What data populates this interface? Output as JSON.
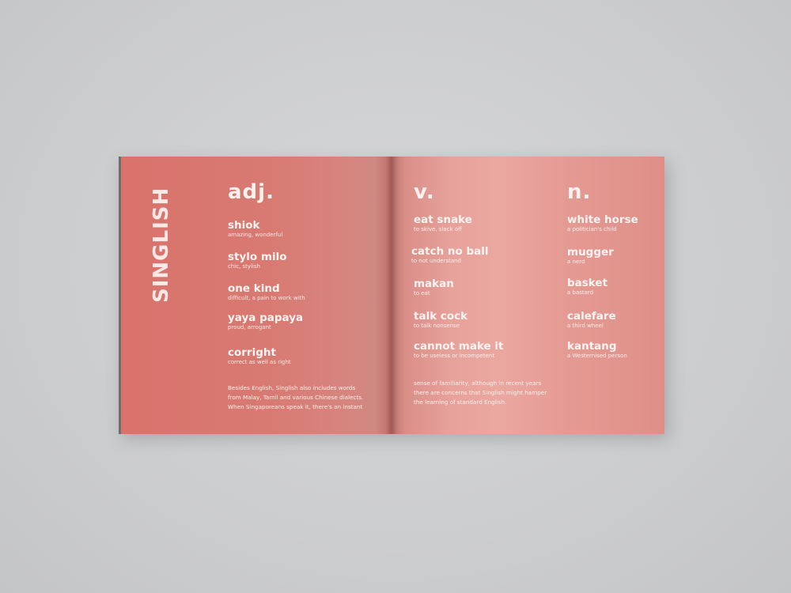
{
  "title": "SINGLISH",
  "adj": {
    "heading": "adj.",
    "entries": [
      {
        "term": "shiok",
        "definition": "amazing, wonderful"
      },
      {
        "term": "stylo milo",
        "definition": "chic, stylish"
      },
      {
        "term": "one kind",
        "definition": "difficult, a pain to work with"
      },
      {
        "term": "yaya papaya",
        "definition": "proud, arrogant"
      },
      {
        "term": "corright",
        "definition": "correct as well as right"
      }
    ]
  },
  "verb": {
    "heading": "v.",
    "entries": [
      {
        "term": "eat snake",
        "definition": "to skive, slack off"
      },
      {
        "term": "catch no ball",
        "definition": "to not understand"
      },
      {
        "term": "makan",
        "definition": "to eat"
      },
      {
        "term": "talk cock",
        "definition": "to talk nonsense"
      },
      {
        "term": "cannot make it",
        "definition": "to be useless or incompetent"
      }
    ]
  },
  "noun": {
    "heading": "n.",
    "entries": [
      {
        "term": "white horse",
        "definition": "a politician's child"
      },
      {
        "term": "mugger",
        "definition": "a nerd"
      },
      {
        "term": "basket",
        "definition": "a bastard"
      },
      {
        "term": "calefare",
        "definition": "a third wheel"
      },
      {
        "term": "kantang",
        "definition": "a Westernised person"
      }
    ]
  },
  "paragraph_left": [
    "Besides English, Singlish also includes words",
    "from Malay, Tamil and various Chinese dialects.",
    "When Singaporeans speak it, there's an instant"
  ],
  "paragraph_right": [
    "sense of familiarity, although in recent years",
    "there are concerns that Singlish might hamper",
    "the learning of standard English."
  ]
}
